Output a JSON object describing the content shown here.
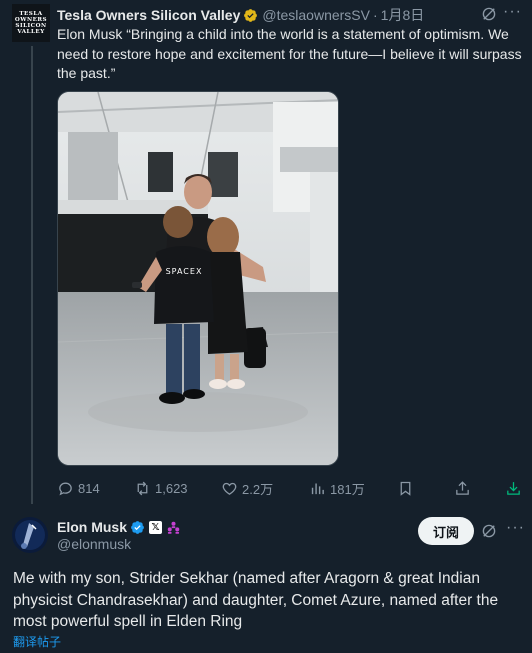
{
  "parent_tweet": {
    "avatar_text": [
      "TESLA",
      "OWNERS",
      "SILICON",
      "VALLEY"
    ],
    "display_name": "Tesla Owners Silicon Valley",
    "handle": "@teslaownersSV",
    "separator": "·",
    "date": "1月8日",
    "text": "Elon Musk “Bringing a child into the world is a statement of optimism. We need to restore hope and excitement for the future—I believe it will surpass the past.”",
    "photo_shirt_text": "SPACEX",
    "stats": {
      "replies": "814",
      "reposts": "1,623",
      "likes": "2.2万",
      "views": "181万"
    }
  },
  "main_tweet": {
    "display_name": "Elon Musk",
    "handle": "@elonmusk",
    "follow_label": "订阅",
    "text": "Me with my son, Strider Sekhar (named after Aragorn & great Indian physicist Chandrasekhar) and daughter, Comet Azure, named after the most powerful spell in Elden Ring",
    "translate_label": "翻译帖子",
    "x_badge": "𝕏"
  },
  "colors": {
    "background": "#15202b",
    "accent": "#1d9bf0",
    "muted": "#8b98a5",
    "verified_gold": "#e2b719"
  }
}
